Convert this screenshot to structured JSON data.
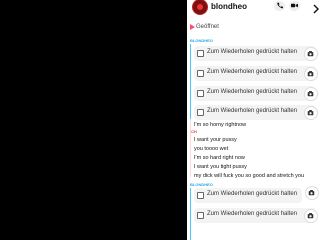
{
  "header": {
    "username": "blondheo"
  },
  "status": {
    "opened_label": "Geöffnet",
    "me_label_1": "BLONDHEO",
    "me_label_2": "BLONDHEO",
    "you_label": "ICH"
  },
  "saved_rows": [
    {
      "label": "Zum Wiederholen gedrückt halten"
    },
    {
      "label": "Zum Wiederholen gedrückt halten"
    },
    {
      "label": "Zum Wiederholen gedrückt halten"
    },
    {
      "label": "Zum Wiederholen gedrückt halten"
    },
    {
      "label": "Zum Wiederholen gedrückt halten"
    },
    {
      "label": "Zum Wiederholen gedrückt halten"
    }
  ],
  "messages": [
    "I'm so horny rightnow",
    "I want your pussy",
    "you toooo wet",
    "I'm so hard right now",
    "I want you tight pussy",
    "my dick will fuck you so good and stretch you"
  ],
  "icons": {
    "call": "phone-icon",
    "video": "video-icon",
    "more": "chevron-right-icon",
    "camera": "camera-icon"
  }
}
